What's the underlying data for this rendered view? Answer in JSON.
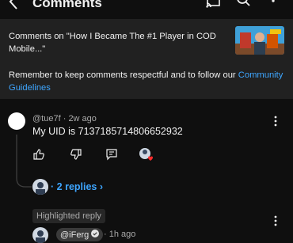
{
  "header": {
    "title": "Comments",
    "icons": [
      "back-arrow-icon",
      "cast-icon",
      "search-icon",
      "more-vert-icon"
    ]
  },
  "context": {
    "video_text": "Comments on \"How I Became The #1 Player in COD Mobile...\"",
    "reminder_text": "Remember to keep comments respectful and to follow our ",
    "guidelines_link": "Community Guidelines"
  },
  "comment": {
    "author": "@tue7f",
    "time": "2w ago",
    "separator": "·",
    "text": "My UID is 7137185714806652932",
    "replies_label": "2 replies"
  },
  "highlighted": {
    "label": "Highlighted reply",
    "author": "@iFerg",
    "time": "1h ago",
    "separator": "·"
  }
}
